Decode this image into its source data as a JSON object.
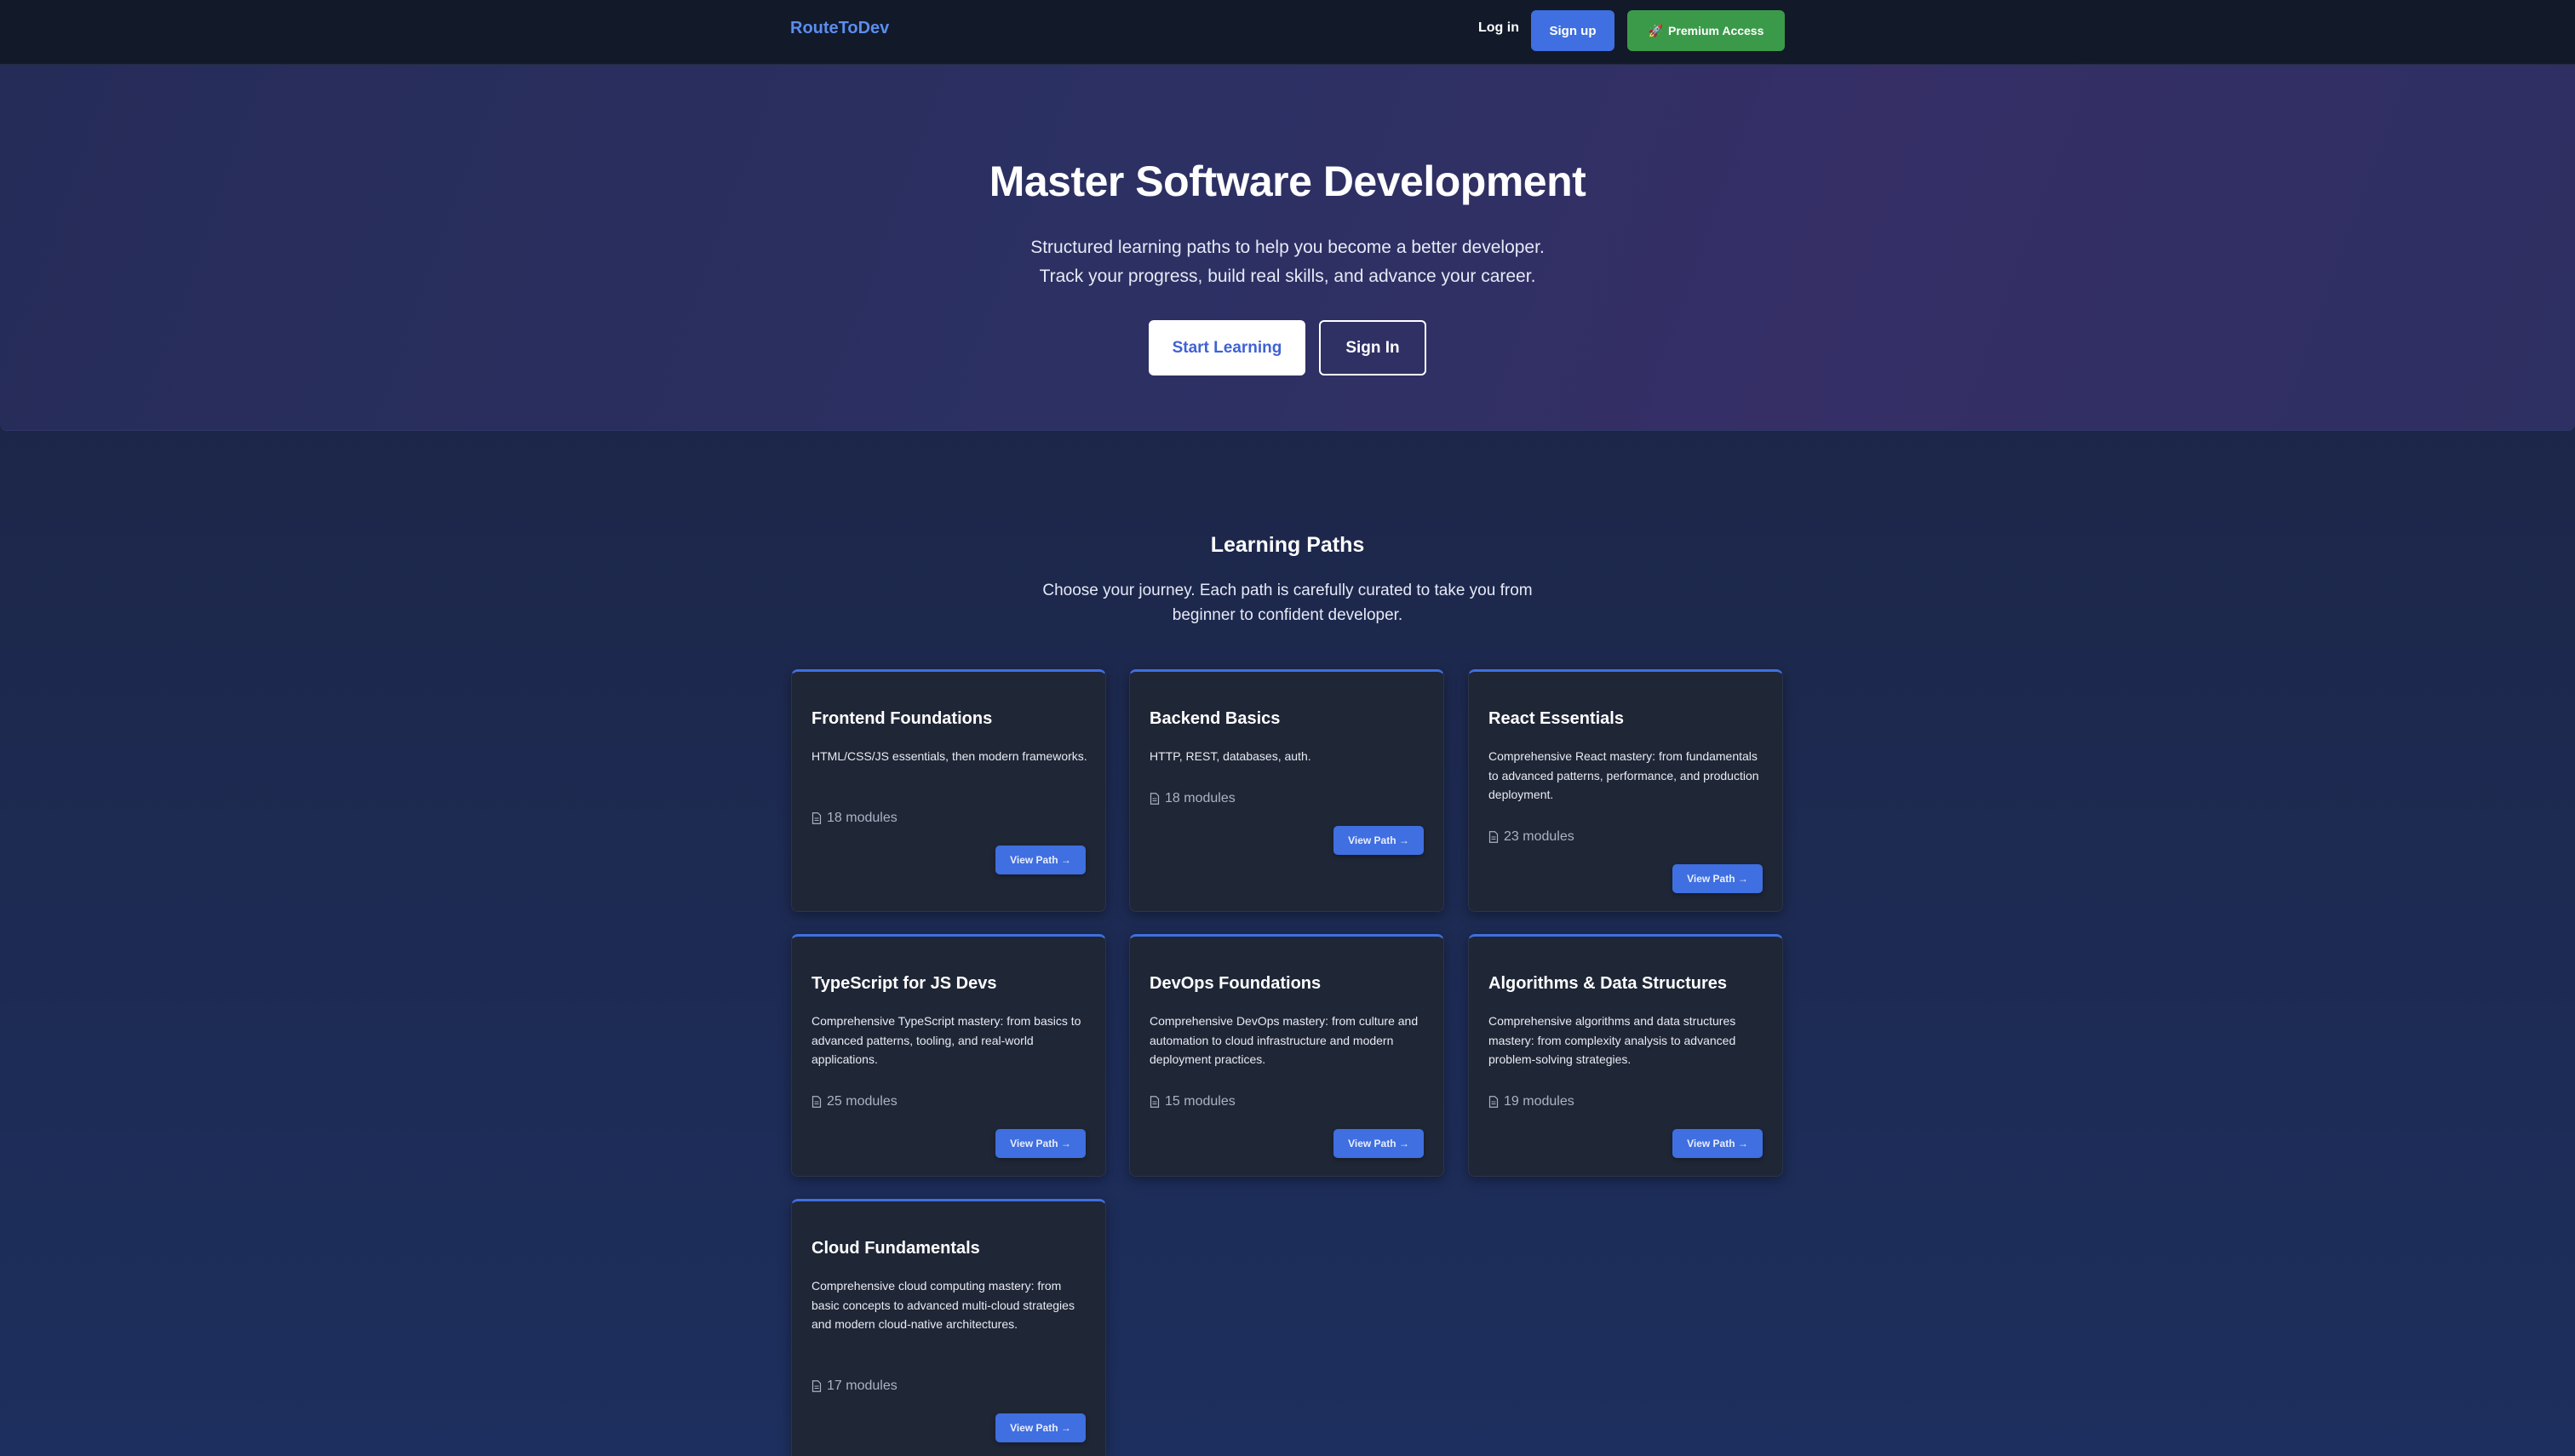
{
  "nav": {
    "brand": "RouteToDev",
    "login": "Log in",
    "signup": "Sign up",
    "premium_icon": "🚀",
    "premium": "Premium Access"
  },
  "hero": {
    "title": "Master Software Development",
    "subtitle_line1": "Structured learning paths to help you become a better developer.",
    "subtitle_line2": "Track your progress, build real skills, and advance your career.",
    "start_button": "Start Learning",
    "signin_button": "Sign In"
  },
  "paths": {
    "title": "Learning Paths",
    "subtitle": "Choose your journey. Each path is carefully curated to take you from beginner to confident developer.",
    "view_label": "View Path →",
    "cards": [
      {
        "title": "Frontend Foundations",
        "description": "HTML/CSS/JS essentials, then modern frameworks.",
        "modules": "18 modules"
      },
      {
        "title": "Backend Basics",
        "description": "HTTP, REST, databases, auth.",
        "modules": "18 modules"
      },
      {
        "title": "React Essentials",
        "description": "Comprehensive React mastery: from fundamentals to advanced patterns, performance, and production deployment.",
        "modules": "23 modules"
      },
      {
        "title": "TypeScript for JS Devs",
        "description": "Comprehensive TypeScript mastery: from basics to advanced patterns, tooling, and real-world applications.",
        "modules": "25 modules"
      },
      {
        "title": "DevOps Foundations",
        "description": "Comprehensive DevOps mastery: from culture and automation to cloud infrastructure and modern deployment practices.",
        "modules": "15 modules"
      },
      {
        "title": "Algorithms & Data Structures",
        "description": "Comprehensive algorithms and data structures mastery: from complexity analysis to advanced problem-solving strategies.",
        "modules": "19 modules"
      },
      {
        "title": "Cloud Fundamentals",
        "description": "Comprehensive cloud computing mastery: from basic concepts to advanced multi-cloud strategies and modern cloud-native architectures.",
        "modules": "17 modules"
      }
    ]
  }
}
